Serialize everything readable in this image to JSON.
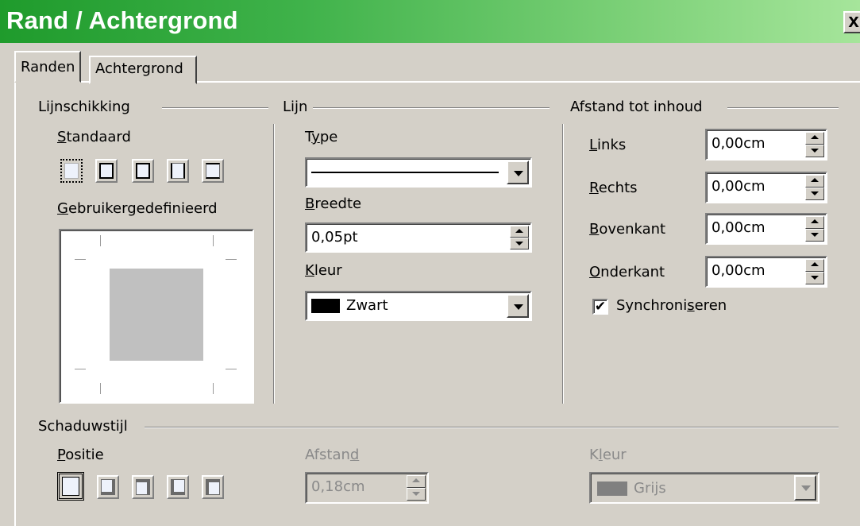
{
  "window": {
    "title": "Rand / Achtergrond",
    "close_label": "x"
  },
  "tabs": [
    {
      "label": "Randen",
      "active": true
    },
    {
      "label": "Achtergrond",
      "active": false
    }
  ],
  "line_arrangement": {
    "heading": "Lijnschikking",
    "default_label": "Standaard",
    "user_defined_label": "Gebruikergedefinieerd",
    "presets": [
      "none",
      "box",
      "outer",
      "left-right",
      "top-bottom"
    ]
  },
  "line": {
    "heading": "Lijn",
    "type_label": "Type",
    "width_label": "Breedte",
    "width_value": "0,05pt",
    "color_label": "Kleur",
    "color_value": "Zwart",
    "color_swatch": "#000000"
  },
  "spacing": {
    "heading": "Afstand tot inhoud",
    "left_label": "Links",
    "left_value": "0,00cm",
    "right_label": "Rechts",
    "right_value": "0,00cm",
    "top_label": "Bovenkant",
    "top_value": "0,00cm",
    "bottom_label": "Onderkant",
    "bottom_value": "0,00cm",
    "sync_label": "Synchroniseren",
    "sync_checked": true
  },
  "shadow": {
    "heading": "Schaduwstijl",
    "position_label": "Positie",
    "distance_label": "Afstand",
    "distance_value": "0,18cm",
    "color_label": "Kleur",
    "color_value": "Grijs",
    "color_swatch": "#808080"
  }
}
